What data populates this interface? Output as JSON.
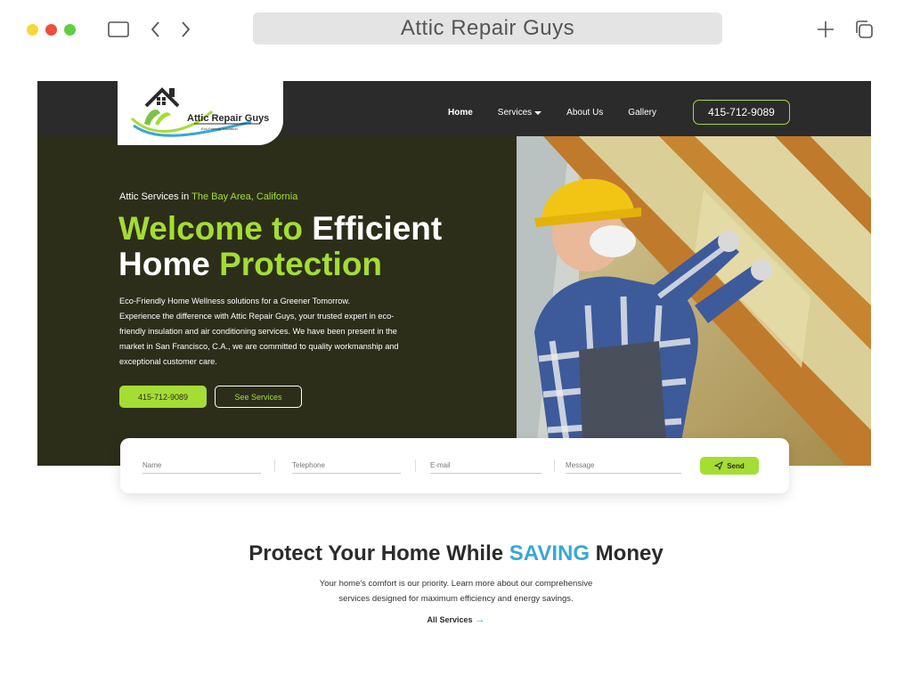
{
  "browser": {
    "address_title": "Attic Repair Guys",
    "traffic_colors": [
      "#f7d83a",
      "#ec4f3e",
      "#5fcf3e"
    ]
  },
  "logo": {
    "name": "Attic Repair Guys",
    "tagline": "Eco-Friendly Insulation"
  },
  "nav": {
    "items": [
      {
        "label": "Home",
        "active": true
      },
      {
        "label": "Services",
        "has_dropdown": true
      },
      {
        "label": "About Us"
      },
      {
        "label": "Gallery"
      }
    ],
    "phone": "415-712-9089"
  },
  "hero": {
    "kicker_prefix": "Attic Services in ",
    "kicker_location": "The Bay Area, California",
    "headline": {
      "line1_green": "Welcome to ",
      "line1_white": "Efficient",
      "line2_white": "Home ",
      "line2_green": "Protection"
    },
    "description_lines": [
      "Eco-Friendly Home Wellness solutions for a Greener Tomorrow.",
      "Experience the difference with Attic Repair Guys, your trusted expert in eco-",
      "friendly insulation and air conditioning services. We have been present in the",
      "market in San Francisco, C.A., we are committed to quality workmanship and",
      "exceptional customer care."
    ],
    "primary_button": "415-712-9089",
    "secondary_button": "See Services",
    "image": "attic-insulation-worker-photo"
  },
  "form": {
    "fields": [
      {
        "placeholder": "Name"
      },
      {
        "placeholder": "Telephone"
      },
      {
        "placeholder": "E-mail"
      },
      {
        "placeholder": "Message"
      }
    ],
    "send_label": "Send"
  },
  "section": {
    "title_prefix": "Protect Your Home While ",
    "title_highlight": "SAVING",
    "title_suffix": " Money",
    "description_lines": [
      "Your home's comfort is our priority. Learn more about our comprehensive",
      "services designed for maximum efficiency and energy savings."
    ],
    "link_label": "All Services"
  },
  "colors": {
    "accent_green": "#a4dd33",
    "accent_blue": "#3aa6d6",
    "dark": "#2b2b2b",
    "hero_bg": "#2c2e1a"
  }
}
